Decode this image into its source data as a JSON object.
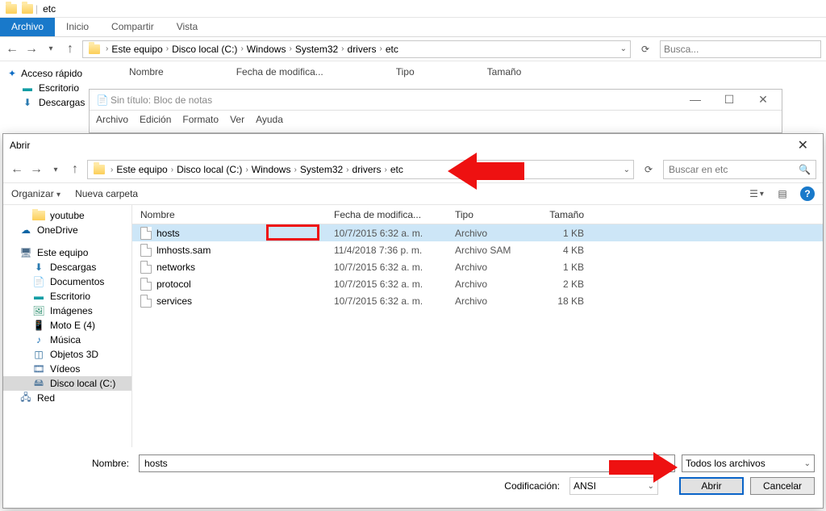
{
  "explorer": {
    "title": "etc",
    "tabs": {
      "file": "Archivo",
      "home": "Inicio",
      "share": "Compartir",
      "view": "Vista"
    },
    "breadcrumb": [
      "Este equipo",
      "Disco local (C:)",
      "Windows",
      "System32",
      "drivers",
      "etc"
    ],
    "search_placeholder": "Busca...",
    "columns": {
      "name": "Nombre",
      "date": "Fecha de modifica...",
      "type": "Tipo",
      "size": "Tamaño"
    },
    "sidebar": {
      "quick": "Acceso rápido",
      "desktop": "Escritorio",
      "downloads": "Descargas"
    }
  },
  "notepad": {
    "title": "Sin título: Bloc de notas",
    "menu": {
      "file": "Archivo",
      "edit": "Edición",
      "format": "Formato",
      "view": "Ver",
      "help": "Ayuda"
    }
  },
  "dialog": {
    "title": "Abrir",
    "breadcrumb": [
      "Este equipo",
      "Disco local (C:)",
      "Windows",
      "System32",
      "drivers",
      "etc"
    ],
    "search_placeholder": "Buscar en etc",
    "toolbar": {
      "organize": "Organizar",
      "newfolder": "Nueva carpeta"
    },
    "tree": [
      {
        "label": "youtube",
        "icon": "folder",
        "lvl": 2
      },
      {
        "label": "OneDrive",
        "icon": "onedrive",
        "lvl": 1
      },
      {
        "label": "Este equipo",
        "icon": "pc",
        "lvl": 1
      },
      {
        "label": "Descargas",
        "icon": "down",
        "lvl": 2
      },
      {
        "label": "Documentos",
        "icon": "doc",
        "lvl": 2
      },
      {
        "label": "Escritorio",
        "icon": "desk",
        "lvl": 2
      },
      {
        "label": "Imágenes",
        "icon": "img",
        "lvl": 2
      },
      {
        "label": "Moto E (4)",
        "icon": "phone",
        "lvl": 2
      },
      {
        "label": "Música",
        "icon": "music",
        "lvl": 2
      },
      {
        "label": "Objetos 3D",
        "icon": "3d",
        "lvl": 2
      },
      {
        "label": "Vídeos",
        "icon": "video",
        "lvl": 2
      },
      {
        "label": "Disco local (C:)",
        "icon": "disk",
        "lvl": 2,
        "selected": true
      },
      {
        "label": "Red",
        "icon": "net",
        "lvl": 1
      }
    ],
    "columns": {
      "name": "Nombre",
      "date": "Fecha de modifica...",
      "type": "Tipo",
      "size": "Tamaño"
    },
    "files": [
      {
        "name": "hosts",
        "date": "10/7/2015 6:32 a. m.",
        "type": "Archivo",
        "size": "1 KB",
        "selected": true
      },
      {
        "name": "lmhosts.sam",
        "date": "11/4/2018 7:36 p. m.",
        "type": "Archivo SAM",
        "size": "4 KB"
      },
      {
        "name": "networks",
        "date": "10/7/2015 6:32 a. m.",
        "type": "Archivo",
        "size": "1 KB"
      },
      {
        "name": "protocol",
        "date": "10/7/2015 6:32 a. m.",
        "type": "Archivo",
        "size": "2 KB"
      },
      {
        "name": "services",
        "date": "10/7/2015 6:32 a. m.",
        "type": "Archivo",
        "size": "18 KB"
      }
    ],
    "footer": {
      "name_label": "Nombre:",
      "name_value": "hosts",
      "encoding_label": "Codificación:",
      "encoding_value": "ANSI",
      "filter_value": "Todos los archivos",
      "open": "Abrir",
      "cancel": "Cancelar"
    }
  }
}
